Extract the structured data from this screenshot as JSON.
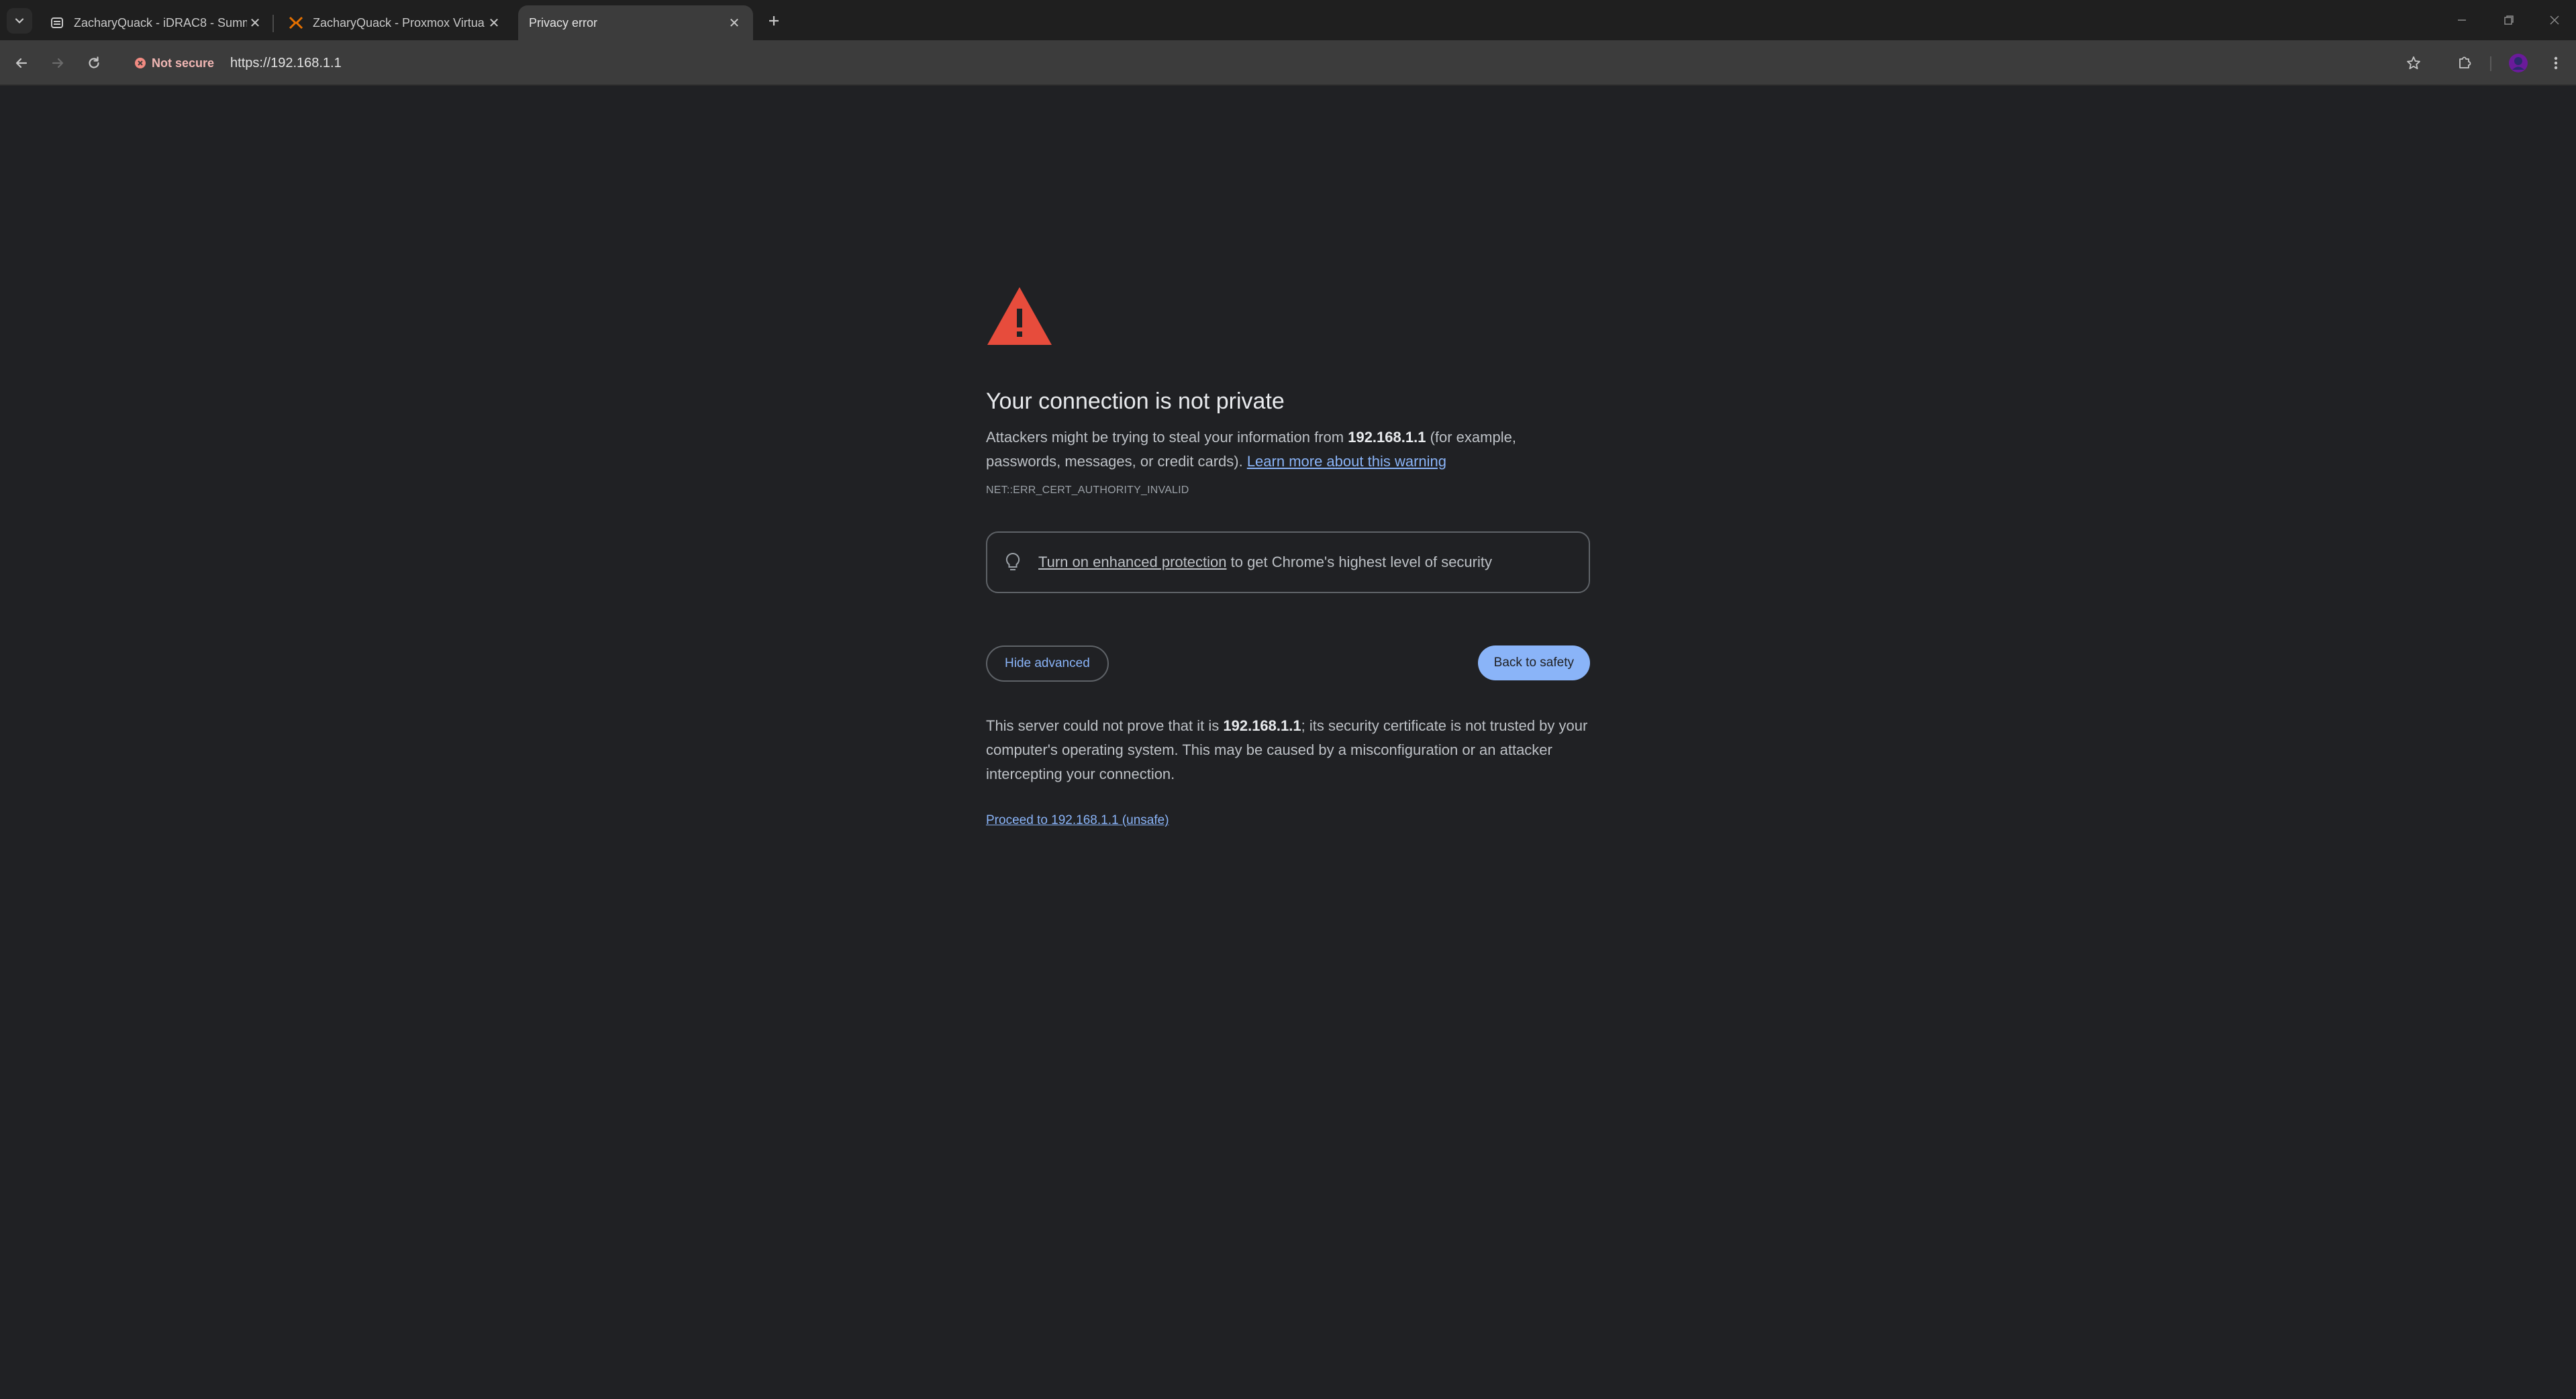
{
  "browser": {
    "tabs": [
      {
        "title": "ZacharyQuack - iDRAC8 - Summ",
        "favicon": "server-icon",
        "active": false
      },
      {
        "title": "ZacharyQuack - Proxmox Virtua",
        "favicon": "proxmox-icon",
        "active": false
      },
      {
        "title": "Privacy error",
        "favicon": "",
        "active": true
      }
    ],
    "security_chip": "Not secure",
    "url": "https://192.168.1.1",
    "accent_color": "#8ab4f8",
    "warning_color": "#e74c3c"
  },
  "interstitial": {
    "heading": "Your connection is not private",
    "intro_before": "Attackers might be trying to steal your information from ",
    "host": "192.168.1.1",
    "intro_after": " (for example, passwords, messages, or credit cards). ",
    "learn_more": "Learn more about this warning",
    "error_code": "NET::ERR_CERT_AUTHORITY_INVALID",
    "enhanced_link": "Turn on enhanced protection",
    "enhanced_rest": " to get Chrome's highest level of security",
    "hide_advanced": "Hide advanced",
    "back_to_safety": "Back to safety",
    "details_before": "This server could not prove that it is ",
    "details_host": "192.168.1.1",
    "details_after": "; its security certificate is not trusted by your computer's operating system. This may be caused by a misconfiguration or an attacker intercepting your connection.",
    "proceed": "Proceed to 192.168.1.1 (unsafe)"
  }
}
